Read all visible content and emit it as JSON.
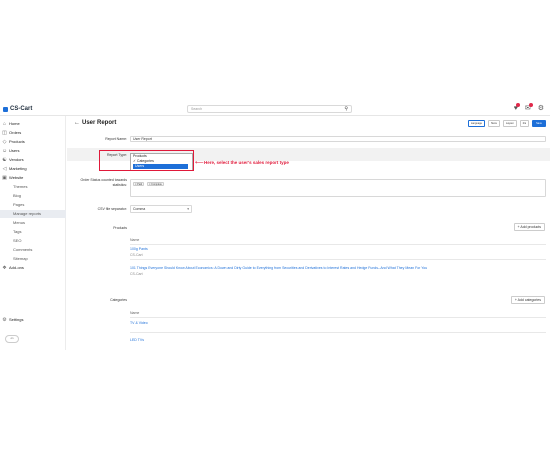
{
  "brand": {
    "logo_text": "CS-Cart",
    "accent": "#1d6fd8",
    "annotation_color": "#e0193a"
  },
  "topbar": {
    "search_placeholder": "Search"
  },
  "sidebar": {
    "items": [
      {
        "label": "Home",
        "icon": "home-icon"
      },
      {
        "label": "Orders",
        "icon": "orders-icon"
      },
      {
        "label": "Products",
        "icon": "tag-icon"
      },
      {
        "label": "Users",
        "icon": "user-icon"
      },
      {
        "label": "Vendors",
        "icon": "vendors-icon"
      },
      {
        "label": "Marketing",
        "icon": "megaphone-icon"
      },
      {
        "label": "Website",
        "icon": "monitor-icon"
      },
      {
        "label": "Themes"
      },
      {
        "label": "Blog"
      },
      {
        "label": "Pages"
      },
      {
        "label": "Manage reports"
      },
      {
        "label": "Menus"
      },
      {
        "label": "Tags"
      },
      {
        "label": "SEO"
      },
      {
        "label": "Comments"
      },
      {
        "label": "Sitemap"
      },
      {
        "label": "Add-ons",
        "icon": "puzzle-icon"
      },
      {
        "label": "Settings",
        "icon": "gear-icon"
      }
    ],
    "toggle_label": "on"
  },
  "header": {
    "title": "User Report",
    "buttons": [
      "Language",
      "Store",
      "Layout",
      "Save"
    ]
  },
  "form": {
    "report_name_label": "Report Name:",
    "report_name_value": "User Report",
    "report_type_label": "Report Type:",
    "report_type_options": [
      "Products",
      "Categories",
      "Users"
    ],
    "report_type_checked": "Categories",
    "report_type_selected": "Users",
    "order_status_label": "Order Status counted towards statistics:",
    "order_status_chips": [
      "Paid",
      "Complete"
    ],
    "csv_label": "CSV file separator:",
    "csv_value": "Comma"
  },
  "annotation": {
    "arrow": "⟵",
    "text": "Here, select the user's sales report type"
  },
  "products": {
    "label": "Products",
    "add_button": "+ Add products",
    "column_header": "Name",
    "items": [
      {
        "name": "100g Pants",
        "vendor": "CS-Cart"
      },
      {
        "name": "101 Things Everyone Should Know About Economics: A Down and Dirty Guide to Everything from Securities and Derivatives to Interest Rates and Hedge Funds--And What They Mean For You",
        "vendor": "CS-Cart"
      }
    ]
  },
  "categories": {
    "label": "Categories",
    "add_button": "+ Add categories",
    "column_header": "Name",
    "items": [
      "TV & Video",
      "LED TVs"
    ]
  }
}
